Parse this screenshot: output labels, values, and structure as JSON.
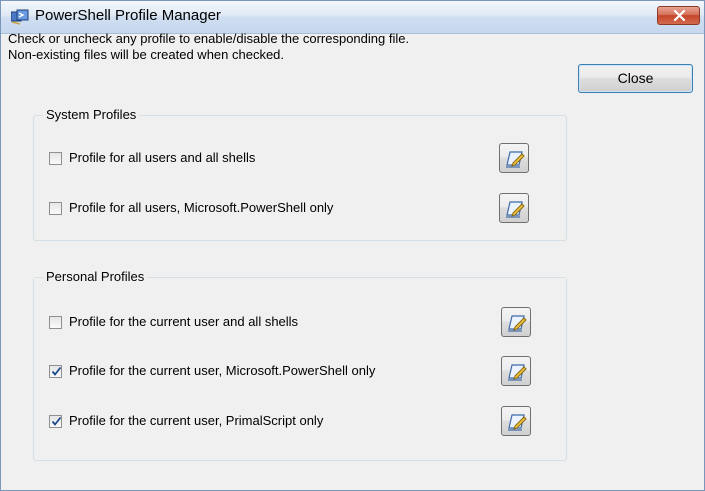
{
  "window": {
    "title": "PowerShell Profile Manager"
  },
  "description": {
    "line1": "Check or uncheck any profile to enable/disable the corresponding file.",
    "line2": "Non-existing files will be created when checked."
  },
  "close_button": {
    "label": "Close"
  },
  "system_profiles": {
    "title": "System Profiles",
    "items": [
      {
        "label": "Profile for all users and all shells",
        "checked": false
      },
      {
        "label": "Profile for all users, Microsoft.PowerShell only",
        "checked": false
      }
    ]
  },
  "personal_profiles": {
    "title": "Personal Profiles",
    "items": [
      {
        "label": "Profile for the current user and all shells",
        "checked": false
      },
      {
        "label": "Profile for the current user, Microsoft.PowerShell only",
        "checked": true
      },
      {
        "label": "Profile for the current user, PrimalScript only",
        "checked": true
      }
    ]
  },
  "icons": {
    "app": "powershell-app-icon",
    "edit": "edit-notepad-icon",
    "close": "close-x-icon"
  },
  "colors": {
    "titlebar": "#dfe9f5",
    "close_red": "#c4452a",
    "accent": "#3c7fb1",
    "check": "#1b4a8c"
  }
}
